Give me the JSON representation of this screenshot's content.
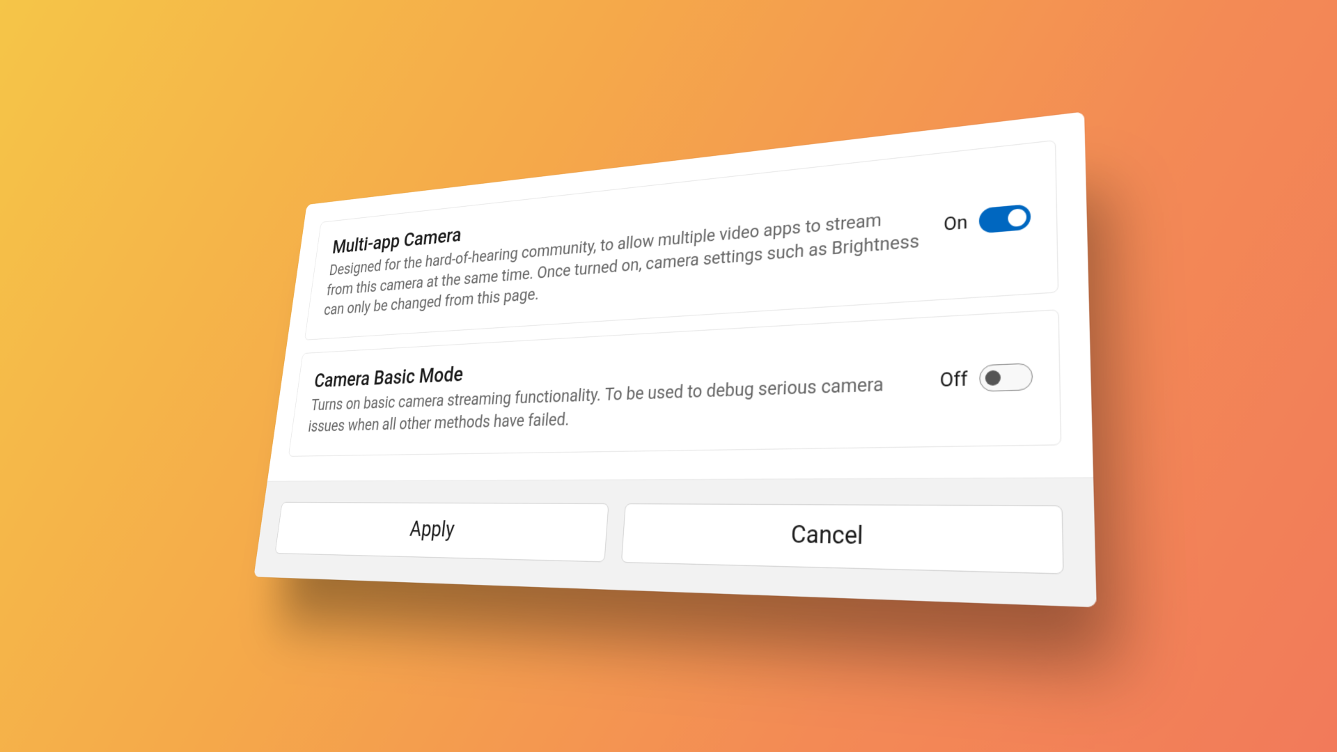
{
  "settings": [
    {
      "title": "Multi-app Camera",
      "description": "Designed for the hard-of-hearing community, to allow multiple video apps to stream from this camera at the same time. Once turned on, camera settings such as Brightness can only be changed from this page.",
      "state_label": "On",
      "state": "on"
    },
    {
      "title": "Camera Basic Mode",
      "description": "Turns on basic camera streaming functionality. To be used to debug serious camera issues when all other methods have failed.",
      "state_label": "Off",
      "state": "off"
    }
  ],
  "footer": {
    "apply_label": "Apply",
    "cancel_label": "Cancel"
  }
}
